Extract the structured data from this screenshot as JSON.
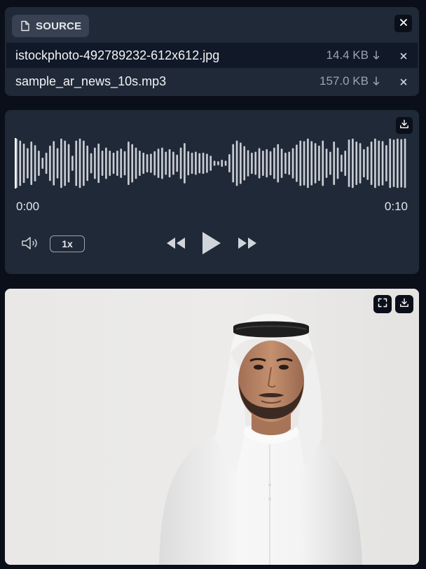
{
  "source": {
    "label": "SOURCE",
    "icon": "file-icon",
    "close_icon": "close-icon"
  },
  "files": [
    {
      "name": "istockphoto-492789232-612x612.jpg",
      "size": "14.4 KB"
    },
    {
      "name": "sample_ar_news_10s.mp3",
      "size": "157.0 KB"
    }
  ],
  "audio": {
    "current_time": "0:00",
    "duration": "0:10",
    "playback_rate": "1x",
    "progress": 0,
    "waveform_amplitudes": [
      0.98,
      0.9,
      0.78,
      0.6,
      0.86,
      0.72,
      0.5,
      0.22,
      0.42,
      0.7,
      0.88,
      0.6,
      0.98,
      0.9,
      0.76,
      0.3,
      0.9,
      0.98,
      0.9,
      0.7,
      0.4,
      0.62,
      0.78,
      0.5,
      0.62,
      0.5,
      0.42,
      0.5,
      0.58,
      0.48,
      0.86,
      0.76,
      0.62,
      0.5,
      0.42,
      0.36,
      0.38,
      0.48,
      0.58,
      0.62,
      0.46,
      0.56,
      0.46,
      0.34,
      0.62,
      0.8,
      0.48,
      0.42,
      0.46,
      0.4,
      0.42,
      0.38,
      0.3,
      0.1,
      0.08,
      0.14,
      0.1,
      0.36,
      0.76,
      0.9,
      0.82,
      0.68,
      0.52,
      0.42,
      0.46,
      0.6,
      0.5,
      0.56,
      0.48,
      0.62,
      0.76,
      0.58,
      0.42,
      0.46,
      0.6,
      0.74,
      0.9,
      0.88,
      0.98,
      0.88,
      0.8,
      0.7,
      0.9,
      0.58,
      0.46,
      0.86,
      0.62,
      0.34,
      0.5,
      0.94,
      0.98,
      0.86,
      0.8,
      0.56,
      0.66,
      0.86,
      0.98,
      0.9,
      0.88,
      0.72,
      0.98,
      0.94,
      0.98,
      0.96,
      0.98
    ],
    "colors": {
      "wave": "#c9ccd3",
      "played": "#ffffff"
    }
  },
  "icons": {
    "download": "download-icon",
    "fullscreen": "fullscreen-icon",
    "volume": "volume-icon",
    "rewind": "rewind-icon",
    "play": "play-icon",
    "forward": "fast-forward-icon"
  }
}
